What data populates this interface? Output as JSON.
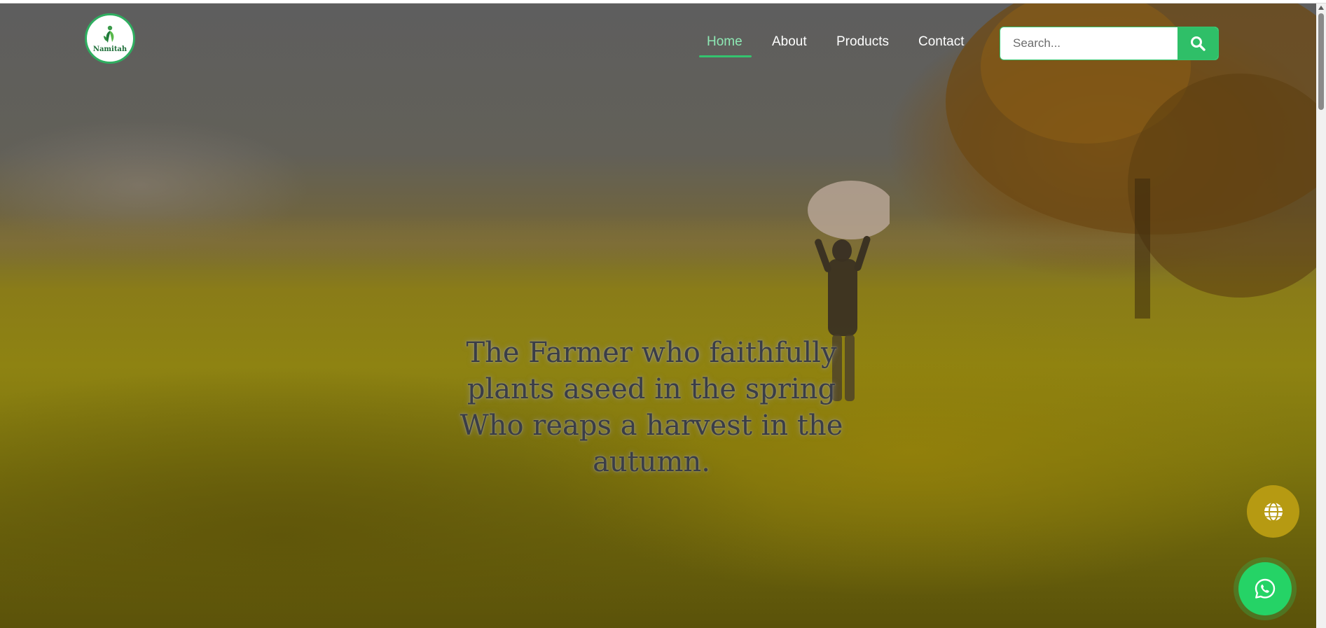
{
  "brand": {
    "logo_text": "Namitah",
    "logo_icon": "leaf-person-icon",
    "accent_color": "#2fbf68"
  },
  "nav": {
    "items": [
      {
        "label": "Home",
        "active": true
      },
      {
        "label": "About",
        "active": false
      },
      {
        "label": "Products",
        "active": false
      },
      {
        "label": "Contact",
        "active": false
      }
    ]
  },
  "search": {
    "placeholder": "Search...",
    "value": "",
    "button_icon": "search-icon"
  },
  "hero": {
    "headline": "The Farmer who faithfully plants aseed in the spring Who reaps a harvest in the autumn."
  },
  "floating_buttons": {
    "language_icon": "globe-icon",
    "language_color": "#b69a12",
    "chat_icon": "whatsapp-icon",
    "chat_color": "#25d366"
  }
}
